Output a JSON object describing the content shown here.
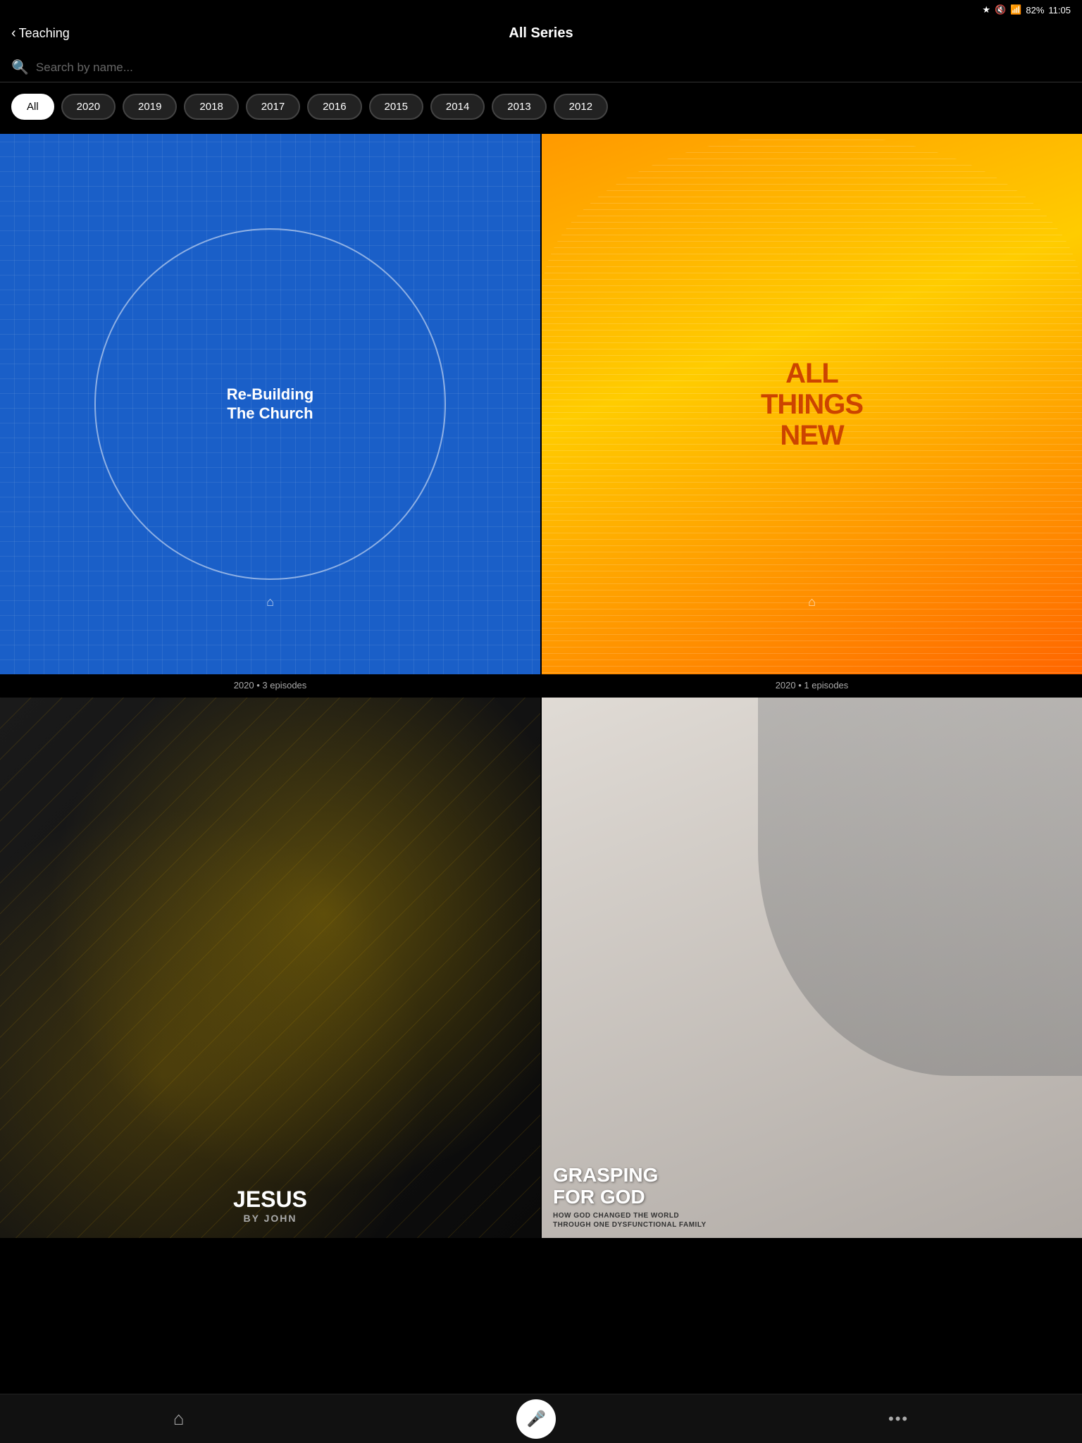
{
  "statusBar": {
    "battery": "82%",
    "time": "11:05"
  },
  "header": {
    "backLabel": "Teaching",
    "title": "All Series"
  },
  "search": {
    "placeholder": "Search by name..."
  },
  "filters": [
    {
      "id": "all",
      "label": "All",
      "active": true
    },
    {
      "id": "2020",
      "label": "2020",
      "active": false
    },
    {
      "id": "2019",
      "label": "2019",
      "active": false
    },
    {
      "id": "2018",
      "label": "2018",
      "active": false
    },
    {
      "id": "2017",
      "label": "2017",
      "active": false
    },
    {
      "id": "2016",
      "label": "2016",
      "active": false
    },
    {
      "id": "2015",
      "label": "2015",
      "active": false
    },
    {
      "id": "2014",
      "label": "2014",
      "active": false
    },
    {
      "id": "2013",
      "label": "2013",
      "active": false
    },
    {
      "id": "2012",
      "label": "2012",
      "active": false
    }
  ],
  "series": [
    {
      "id": "rebuilding",
      "title": "Re-Building The Church",
      "meta": "2020 • 3 episodes",
      "cardType": "rebuilding"
    },
    {
      "id": "allthings",
      "title": "All Things New",
      "meta": "2020 • 1 episodes",
      "cardType": "allthings"
    },
    {
      "id": "jesus",
      "title": "Jesus By John",
      "meta": "",
      "cardType": "jesus",
      "subtitle": "BY JOHN"
    },
    {
      "id": "grasping",
      "title": "Grasping For God",
      "meta": "",
      "cardType": "grasping",
      "subtitle": "HOW GOD CHANGED THE WORLD THROUGH ONE DYSFUNCTIONAL FAMILY"
    }
  ],
  "nav": {
    "homeLabel": "Home",
    "moreLabel": "More"
  }
}
